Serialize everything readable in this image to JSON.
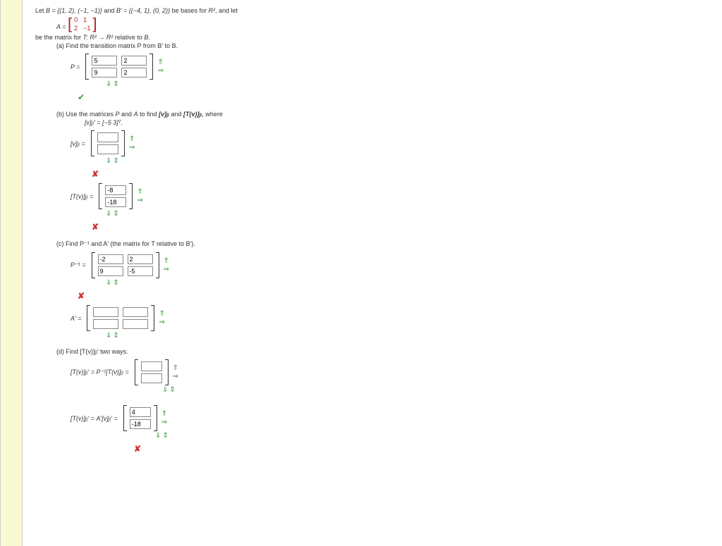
{
  "intro": {
    "line1_pre": "Let ",
    "line1_B": "B = {(1, 2), (−1, −1)}",
    "line1_mid": " and ",
    "line1_Bp": "B′ = {(−4, 1), (0, 2)}",
    "line1_post": " be bases for ",
    "line1_R2": "R²",
    "line1_end": ", and let",
    "A_label": "A = ",
    "A_matrix": [
      [
        "0",
        "1"
      ],
      [
        "2",
        "−1"
      ]
    ],
    "line3_pre": "be the matrix for ",
    "line3_T": "T: R² → R²",
    "line3_post": " relative to ",
    "line3_B": "B"
  },
  "partA": {
    "prompt": "(a) Find the transition matrix P from B′ to B.",
    "label": "P =",
    "cells": [
      [
        "5",
        "2"
      ],
      [
        "9",
        "2"
      ]
    ]
  },
  "partB": {
    "prompt_pre": "(b) Use the matrices ",
    "prompt_PA": "P",
    "prompt_and": " and ",
    "prompt_A": "A",
    "prompt_mid": " to find ",
    "prompt_v": "[v]ᵦ",
    "prompt_and2": " and ",
    "prompt_Tv": "[T(v)]ᵦ",
    "prompt_where": ", where",
    "given": "[v]ᵦ′ = [−5  3]ᵀ.",
    "label1": "[v]ᵦ =",
    "cells1": [
      [
        ""
      ],
      [
        ""
      ]
    ],
    "label2": "[T(v)]ᵦ =",
    "cells2": [
      [
        "-8"
      ],
      [
        "-18"
      ]
    ]
  },
  "partC": {
    "prompt": "(c) Find P⁻¹ and A′ (the matrix for T relative to B′).",
    "label1": "P⁻¹ =",
    "cells1": [
      [
        "-2",
        "2"
      ],
      [
        "9",
        "-5"
      ]
    ],
    "label2": "A′ =",
    "cells2": [
      [
        "",
        ""
      ],
      [
        "",
        ""
      ]
    ]
  },
  "partD": {
    "prompt": "(d) Find [T(v)]ᵦ′ two ways.",
    "label1": "[T(v)]ᵦ′ = P⁻¹[T(v)]ᵦ =",
    "cells1": [
      [
        ""
      ],
      [
        ""
      ]
    ],
    "label2": "[T(v)]ᵦ′ = A′[v]ᵦ′ =",
    "cells2": [
      [
        "4"
      ],
      [
        "-18"
      ]
    ]
  },
  "arrows": {
    "up": "⇑",
    "right": "⇒",
    "down": "⇓",
    "fill": "⇕"
  }
}
